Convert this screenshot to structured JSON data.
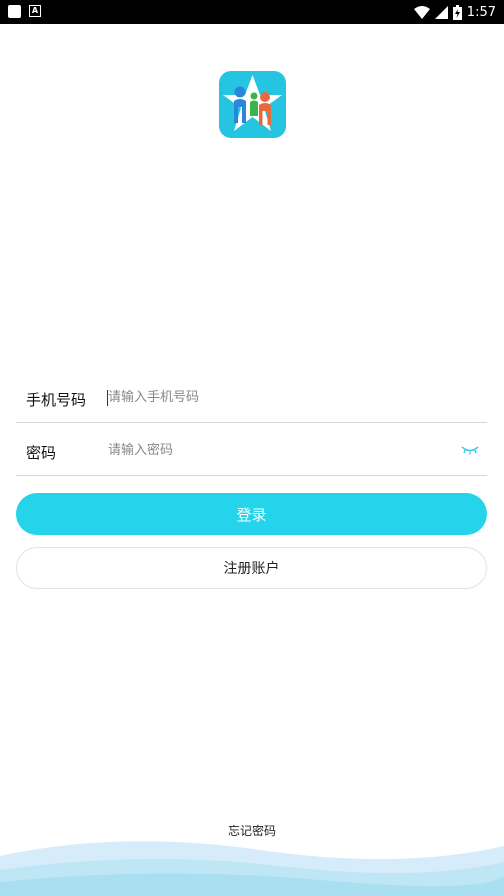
{
  "status_bar": {
    "time": "1:57",
    "notif_letter": "A"
  },
  "login_form": {
    "phone_label": "手机号码",
    "phone_placeholder": "请输入手机号码",
    "password_label": "密码",
    "password_placeholder": "请输入密码"
  },
  "buttons": {
    "login": "登录",
    "register": "注册账户"
  },
  "forgot_password": "忘记密码",
  "colors": {
    "accent": "#25d4ea",
    "logo_bg": "#25c5e2"
  },
  "icons": [
    "notification-icon",
    "app-logo-icon",
    "eye-closed-icon",
    "wifi-icon",
    "signal-icon",
    "battery-icon"
  ]
}
